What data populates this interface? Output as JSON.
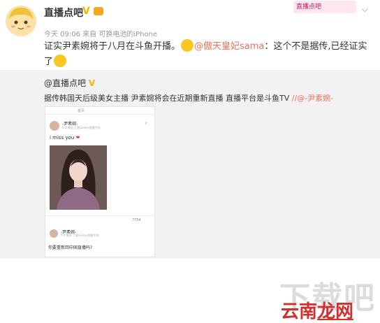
{
  "post": {
    "author": "直播点吧",
    "verified_mark": "V",
    "meta": "今天 09:06 来自 可换电池的iPhone",
    "text_before": "证实尹素婉将于八月在斗鱼开播。",
    "mention": "@傲天皇妃sama",
    "text_after": "：这个不是据传,已经证实了",
    "banner": "直播点吧"
  },
  "repost": {
    "author": "@直播点吧",
    "verified_mark": "V",
    "text": "据传韩国天后级美女主播 尹素婉将会在近期重新直播 直播平台是斗鱼TV",
    "mention": "//@-尹素婉-"
  },
  "embedded_card": {
    "tabs": [
      "",
      "首页",
      "",
      ""
    ],
    "user1": {
      "name": "-尹素婉-",
      "meta": "5-3 来自 三星Galaxy智能手机"
    },
    "message": "i miss you",
    "actions": [
      "",
      "",
      "",
      "7764"
    ],
    "user2": {
      "name": "-尹素婉-",
      "meta": "5-4 来自 三星Galaxy智能手机"
    },
    "question": "你要重新回中国直播吗?"
  },
  "watermark": {
    "top": "下载吧",
    "brand_a": "云南",
    "brand_b": "龙网"
  }
}
